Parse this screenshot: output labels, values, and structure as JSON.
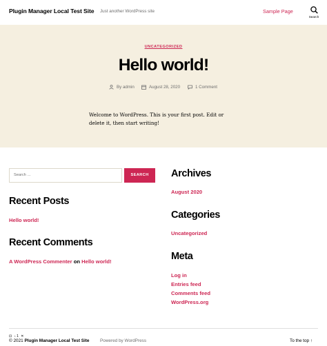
{
  "header": {
    "site_title": "Plugin Manager Local Test Site",
    "site_description": "Just another WordPress site",
    "nav_link": "Sample Page",
    "search_label": "Search"
  },
  "post": {
    "category": "UNCATEGORIZED",
    "title": "Hello world!",
    "author": "By admin",
    "date": "August 28, 2020",
    "comments": "1 Comment",
    "content": "Welcome to WordPress. This is your first post. Edit or delete it, then start writing!"
  },
  "search_widget": {
    "label": "Search …",
    "button": "SEARCH"
  },
  "recent_posts": {
    "title": "Recent Posts",
    "items": [
      "Hello world!"
    ]
  },
  "recent_comments": {
    "title": "Recent Comments",
    "author": "A WordPress Commenter",
    "on": "on",
    "post": "Hello world!"
  },
  "archives": {
    "title": "Archives",
    "items": [
      "August 2020"
    ]
  },
  "categories": {
    "title": "Categories",
    "items": [
      "Uncategorized"
    ]
  },
  "meta": {
    "title": "Meta",
    "items": [
      "Log in",
      "Entries feed",
      "Comments feed",
      "WordPress.org"
    ]
  },
  "footer": {
    "copyright_symbol": "©",
    "year": "2021",
    "site_name": "Plugin Manager Local Test Site",
    "powered_by": "Powered by WordPress",
    "to_top": "To the top ↑",
    "overlay": "⊡ ↓1 ✕"
  },
  "colors": {
    "accent": "#cd2653",
    "hero_background": "#f5efe0",
    "secondary_text": "#6d6d6d"
  }
}
